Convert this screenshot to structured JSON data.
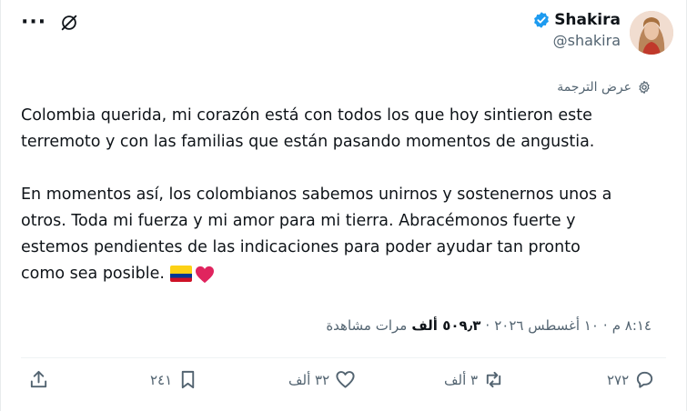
{
  "header": {
    "more_label": "···"
  },
  "author": {
    "display_name": "Shakira",
    "handle": "@shakira",
    "verified_color": "#1d9bf0"
  },
  "translate": {
    "label": "عرض الترجمة"
  },
  "tweet": {
    "text": "Colombia querida, mi corazón está con todos los que hoy sintieron este\nterremoto y con las familias que están pasando momentos de angustia.\n\nEn momentos así, los colombianos sabemos unirnos y sostenernos unos a\notros. Toda mi fuerza y mi amor para mi tierra. Abracémonos fuerte y\nestemos pendientes de las indicaciones para poder ayudar tan pronto\ncomo sea posible."
  },
  "meta": {
    "time": "٨:١٤ م",
    "separator": "·",
    "date": "١٠ أغسطس ٢٠٢٦",
    "views_count": "٥٠٩٫٣ ألف",
    "views_label": "مرات مشاهدة"
  },
  "actions": {
    "replies": "٢٧٢",
    "retweets": "٣ ألف",
    "likes": "٣٢ ألف",
    "bookmarks": "٢٤١"
  },
  "colors": {
    "text": "#0f1419",
    "secondary": "#536471",
    "accent": "#1d9bf0",
    "heart": "#e0245e"
  }
}
